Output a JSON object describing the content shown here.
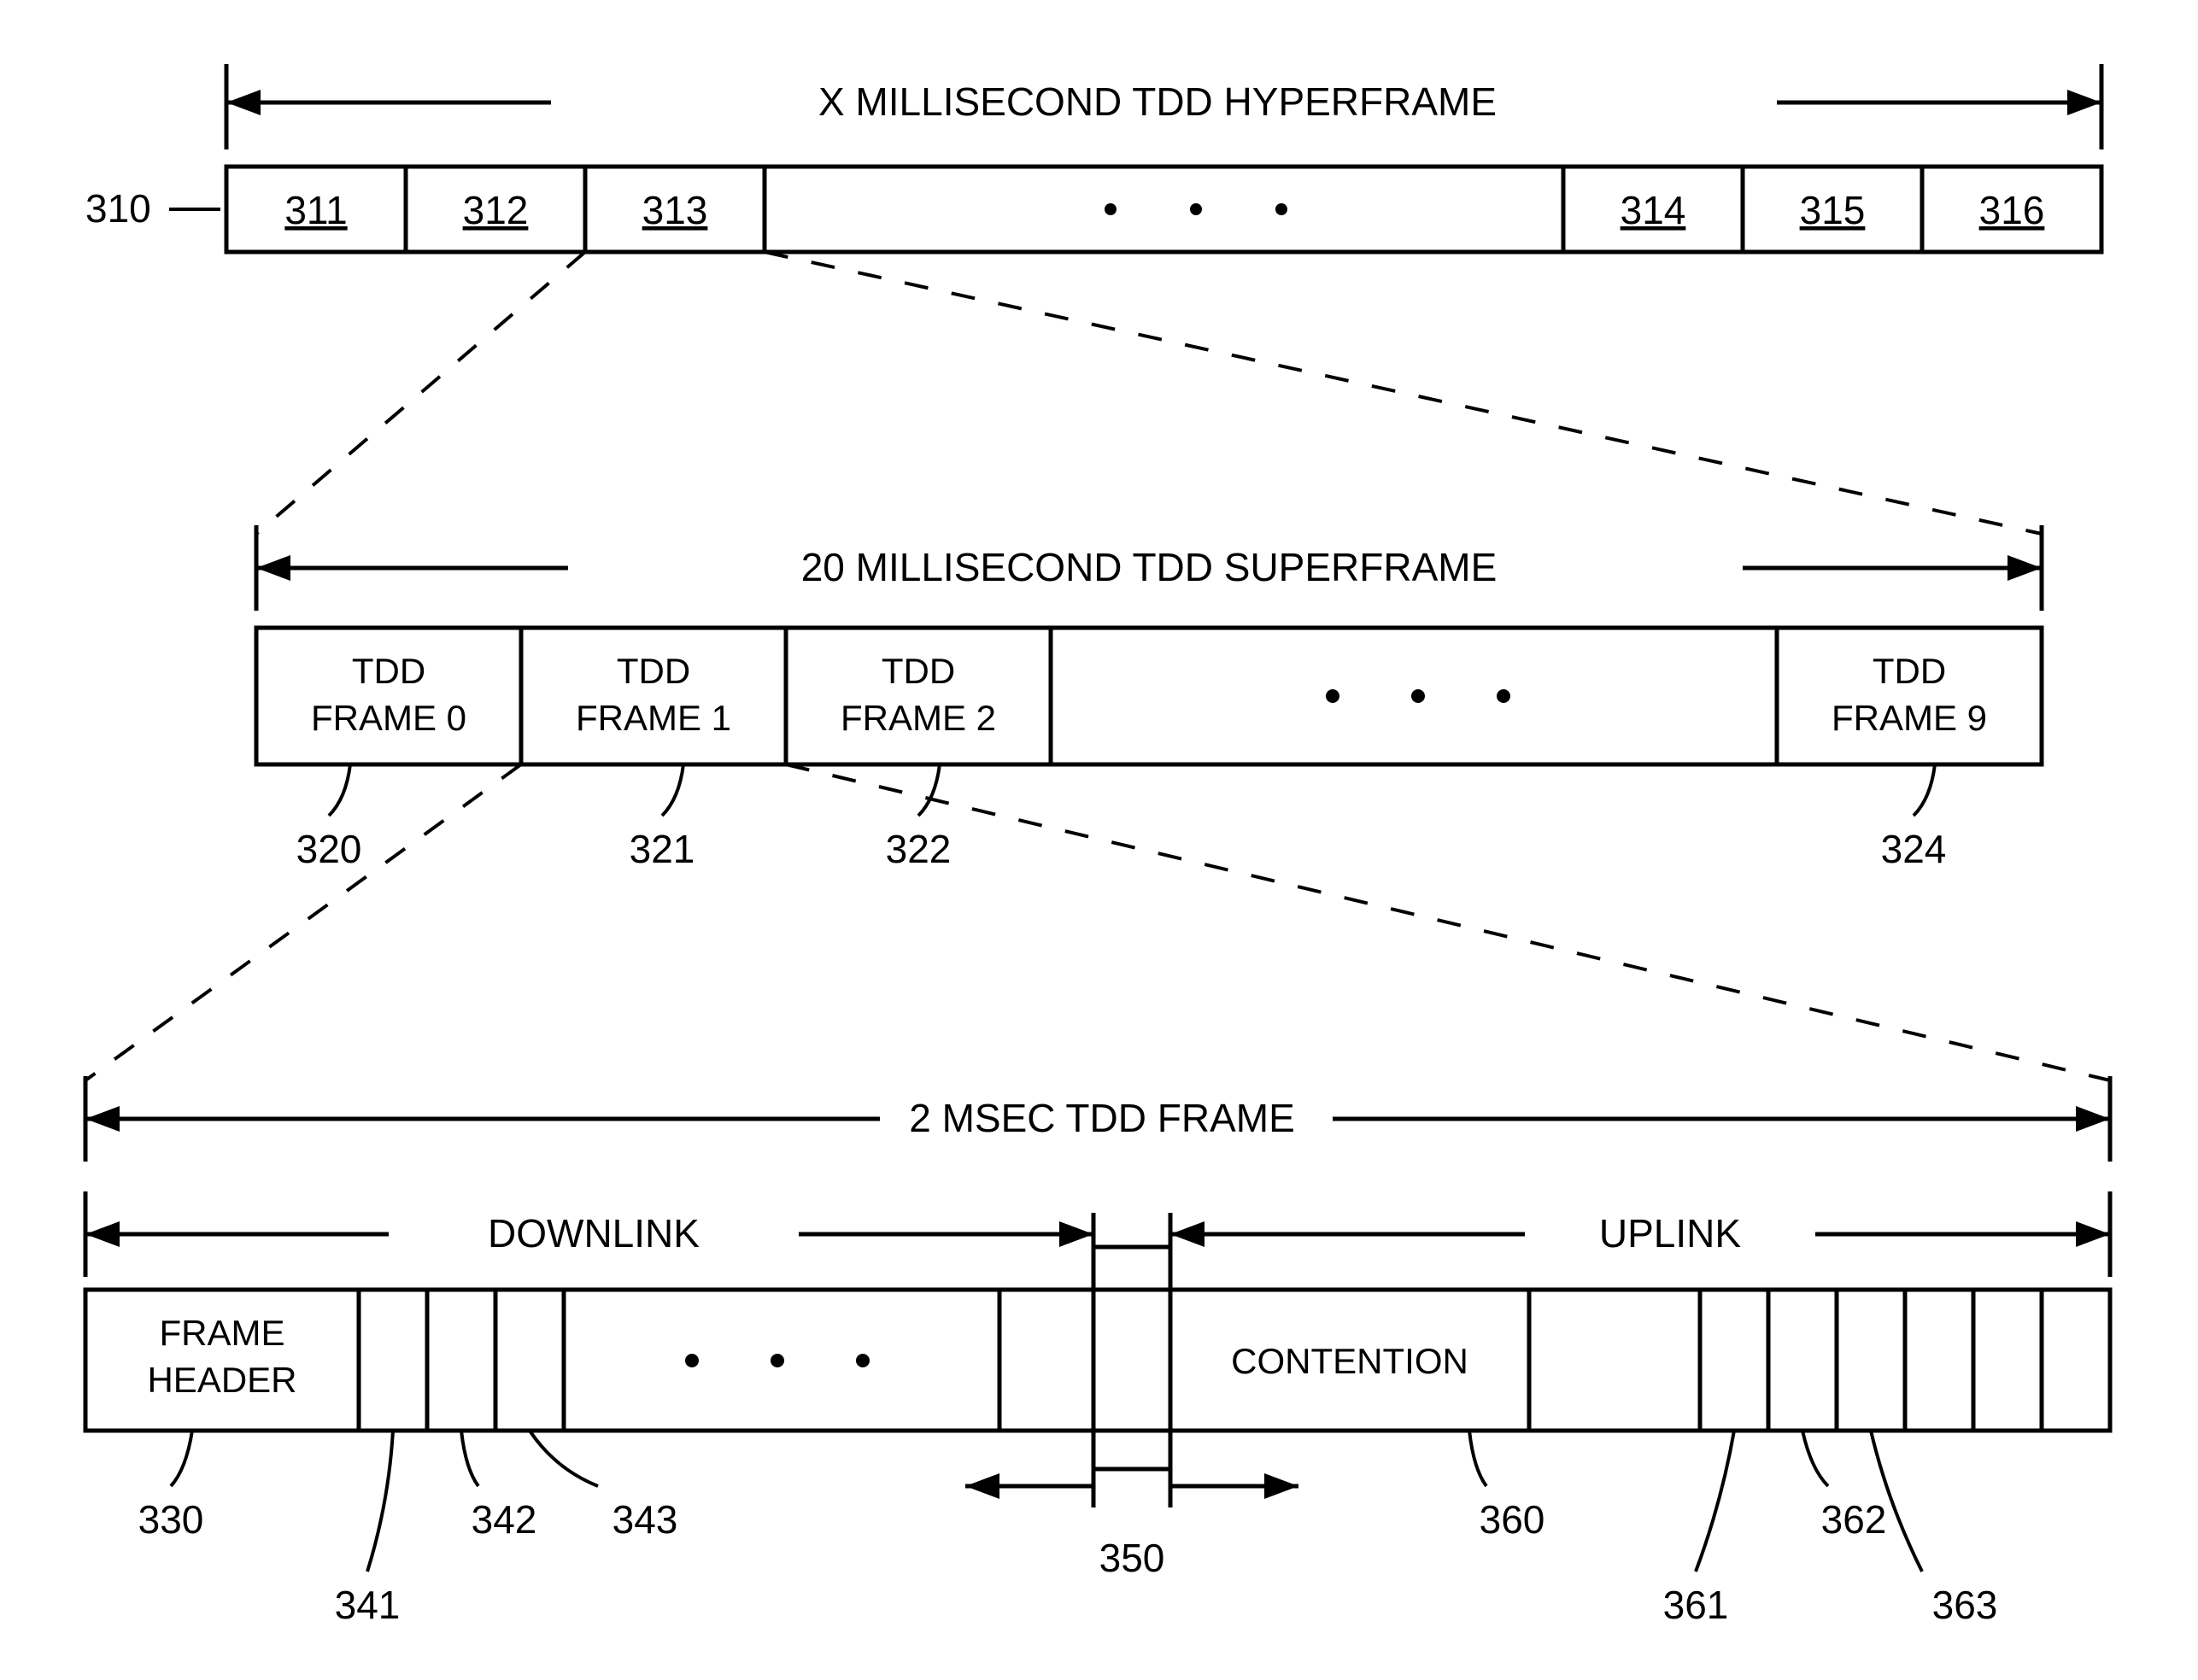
{
  "hyper": {
    "title": "X MILLISECOND TDD HYPERFRAME",
    "ref": "310",
    "cells": [
      "311",
      "312",
      "313",
      "314",
      "315",
      "316"
    ]
  },
  "super": {
    "title": "20 MILLISECOND TDD SUPERFRAME",
    "frames": [
      "TDD FRAME 0",
      "TDD FRAME 1",
      "TDD FRAME 2",
      "TDD FRAME 9"
    ],
    "refs": [
      "320",
      "321",
      "322",
      "324"
    ]
  },
  "frame": {
    "title": "2 MSEC TDD FRAME",
    "downlink": "DOWNLINK",
    "uplink": "UPLINK",
    "header": "FRAME HEADER",
    "contention": "CONTENTION",
    "refs": {
      "r330": "330",
      "r341": "341",
      "r342": "342",
      "r343": "343",
      "r350": "350",
      "r360": "360",
      "r361": "361",
      "r362": "362",
      "r363": "363"
    }
  }
}
